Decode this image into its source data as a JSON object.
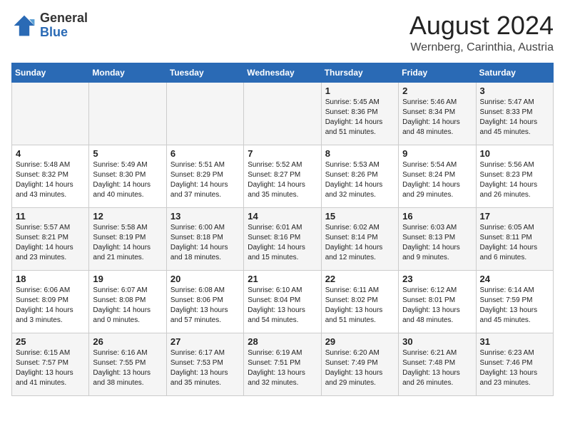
{
  "header": {
    "logo_general": "General",
    "logo_blue": "Blue",
    "month_year": "August 2024",
    "location": "Wernberg, Carinthia, Austria"
  },
  "days_of_week": [
    "Sunday",
    "Monday",
    "Tuesday",
    "Wednesday",
    "Thursday",
    "Friday",
    "Saturday"
  ],
  "weeks": [
    [
      {
        "day": "",
        "info": ""
      },
      {
        "day": "",
        "info": ""
      },
      {
        "day": "",
        "info": ""
      },
      {
        "day": "",
        "info": ""
      },
      {
        "day": "1",
        "info": "Sunrise: 5:45 AM\nSunset: 8:36 PM\nDaylight: 14 hours\nand 51 minutes."
      },
      {
        "day": "2",
        "info": "Sunrise: 5:46 AM\nSunset: 8:34 PM\nDaylight: 14 hours\nand 48 minutes."
      },
      {
        "day": "3",
        "info": "Sunrise: 5:47 AM\nSunset: 8:33 PM\nDaylight: 14 hours\nand 45 minutes."
      }
    ],
    [
      {
        "day": "4",
        "info": "Sunrise: 5:48 AM\nSunset: 8:32 PM\nDaylight: 14 hours\nand 43 minutes."
      },
      {
        "day": "5",
        "info": "Sunrise: 5:49 AM\nSunset: 8:30 PM\nDaylight: 14 hours\nand 40 minutes."
      },
      {
        "day": "6",
        "info": "Sunrise: 5:51 AM\nSunset: 8:29 PM\nDaylight: 14 hours\nand 37 minutes."
      },
      {
        "day": "7",
        "info": "Sunrise: 5:52 AM\nSunset: 8:27 PM\nDaylight: 14 hours\nand 35 minutes."
      },
      {
        "day": "8",
        "info": "Sunrise: 5:53 AM\nSunset: 8:26 PM\nDaylight: 14 hours\nand 32 minutes."
      },
      {
        "day": "9",
        "info": "Sunrise: 5:54 AM\nSunset: 8:24 PM\nDaylight: 14 hours\nand 29 minutes."
      },
      {
        "day": "10",
        "info": "Sunrise: 5:56 AM\nSunset: 8:23 PM\nDaylight: 14 hours\nand 26 minutes."
      }
    ],
    [
      {
        "day": "11",
        "info": "Sunrise: 5:57 AM\nSunset: 8:21 PM\nDaylight: 14 hours\nand 23 minutes."
      },
      {
        "day": "12",
        "info": "Sunrise: 5:58 AM\nSunset: 8:19 PM\nDaylight: 14 hours\nand 21 minutes."
      },
      {
        "day": "13",
        "info": "Sunrise: 6:00 AM\nSunset: 8:18 PM\nDaylight: 14 hours\nand 18 minutes."
      },
      {
        "day": "14",
        "info": "Sunrise: 6:01 AM\nSunset: 8:16 PM\nDaylight: 14 hours\nand 15 minutes."
      },
      {
        "day": "15",
        "info": "Sunrise: 6:02 AM\nSunset: 8:14 PM\nDaylight: 14 hours\nand 12 minutes."
      },
      {
        "day": "16",
        "info": "Sunrise: 6:03 AM\nSunset: 8:13 PM\nDaylight: 14 hours\nand 9 minutes."
      },
      {
        "day": "17",
        "info": "Sunrise: 6:05 AM\nSunset: 8:11 PM\nDaylight: 14 hours\nand 6 minutes."
      }
    ],
    [
      {
        "day": "18",
        "info": "Sunrise: 6:06 AM\nSunset: 8:09 PM\nDaylight: 14 hours\nand 3 minutes."
      },
      {
        "day": "19",
        "info": "Sunrise: 6:07 AM\nSunset: 8:08 PM\nDaylight: 14 hours\nand 0 minutes."
      },
      {
        "day": "20",
        "info": "Sunrise: 6:08 AM\nSunset: 8:06 PM\nDaylight: 13 hours\nand 57 minutes."
      },
      {
        "day": "21",
        "info": "Sunrise: 6:10 AM\nSunset: 8:04 PM\nDaylight: 13 hours\nand 54 minutes."
      },
      {
        "day": "22",
        "info": "Sunrise: 6:11 AM\nSunset: 8:02 PM\nDaylight: 13 hours\nand 51 minutes."
      },
      {
        "day": "23",
        "info": "Sunrise: 6:12 AM\nSunset: 8:01 PM\nDaylight: 13 hours\nand 48 minutes."
      },
      {
        "day": "24",
        "info": "Sunrise: 6:14 AM\nSunset: 7:59 PM\nDaylight: 13 hours\nand 45 minutes."
      }
    ],
    [
      {
        "day": "25",
        "info": "Sunrise: 6:15 AM\nSunset: 7:57 PM\nDaylight: 13 hours\nand 41 minutes."
      },
      {
        "day": "26",
        "info": "Sunrise: 6:16 AM\nSunset: 7:55 PM\nDaylight: 13 hours\nand 38 minutes."
      },
      {
        "day": "27",
        "info": "Sunrise: 6:17 AM\nSunset: 7:53 PM\nDaylight: 13 hours\nand 35 minutes."
      },
      {
        "day": "28",
        "info": "Sunrise: 6:19 AM\nSunset: 7:51 PM\nDaylight: 13 hours\nand 32 minutes."
      },
      {
        "day": "29",
        "info": "Sunrise: 6:20 AM\nSunset: 7:49 PM\nDaylight: 13 hours\nand 29 minutes."
      },
      {
        "day": "30",
        "info": "Sunrise: 6:21 AM\nSunset: 7:48 PM\nDaylight: 13 hours\nand 26 minutes."
      },
      {
        "day": "31",
        "info": "Sunrise: 6:23 AM\nSunset: 7:46 PM\nDaylight: 13 hours\nand 23 minutes."
      }
    ]
  ]
}
